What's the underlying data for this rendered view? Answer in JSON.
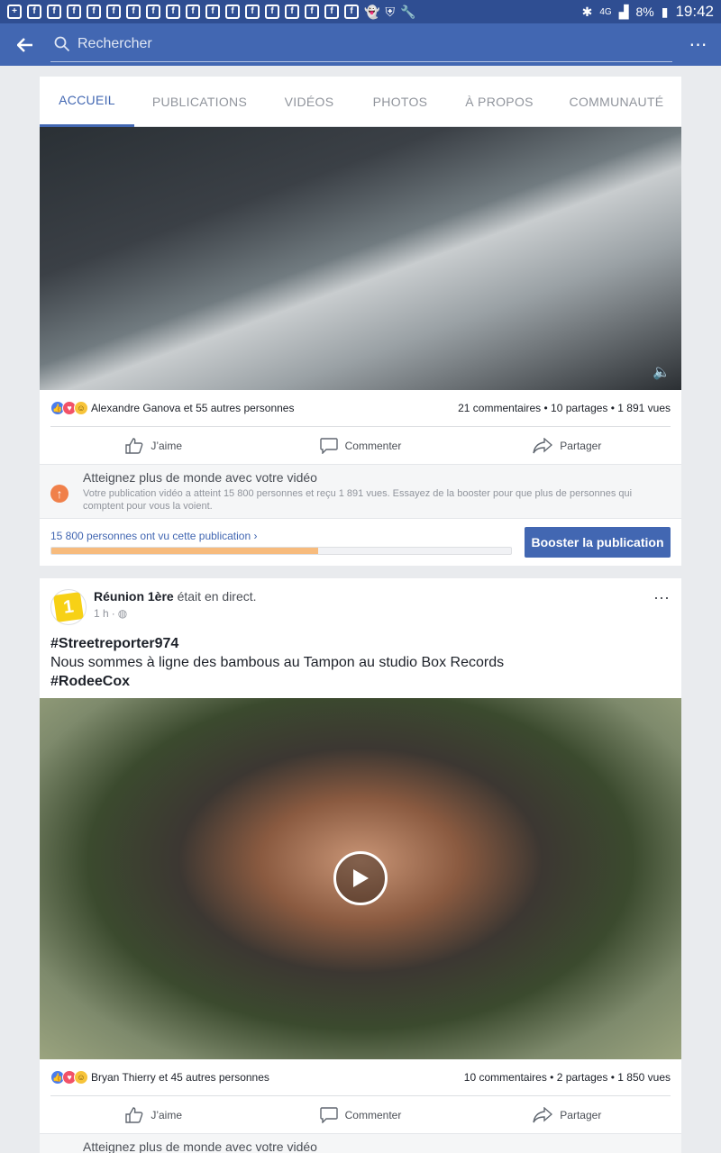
{
  "status_bar": {
    "battery": "8%",
    "time": "19:42",
    "network": "4G"
  },
  "app_bar": {
    "search_placeholder": "Rechercher",
    "more_icon": "overflow-menu-icon"
  },
  "page_tabs": [
    {
      "label": "ACCUEIL",
      "active": true
    },
    {
      "label": "PUBLICATIONS",
      "active": false
    },
    {
      "label": "VIDÉOS",
      "active": false
    },
    {
      "label": "PHOTOS",
      "active": false
    },
    {
      "label": "À PROPOS",
      "active": false
    },
    {
      "label": "COMMUNAUTÉ",
      "active": false
    }
  ],
  "post1": {
    "reactions_text": "Alexandre Ganova et 55 autres personnes",
    "stats_text": "21 commentaires • 10 partages • 1 891 vues",
    "actions": {
      "like": "J’aime",
      "comment": "Commenter",
      "share": "Partager"
    },
    "boost_tip": {
      "title": "Atteignez plus de monde avec votre vidéo",
      "body": "Votre publication vidéo a atteint 15 800 personnes et reçu 1 891 vues. Essayez de la booster pour que plus de personnes qui comptent pour vous la voient."
    },
    "reach_link": "15 800 personnes ont vu cette publication",
    "reach_progress": 0.58,
    "boost_button": "Booster la publication"
  },
  "post2": {
    "page_name": "Réunion 1ère",
    "status": "était en direct.",
    "time": "1 h",
    "hashtag1": "#Streetreporter974",
    "text": "Nous sommes à ligne des bambous au Tampon au studio Box Records",
    "hashtag2": "#RodeeCox",
    "reactions_text": "Bryan Thierry et 45 autres personnes",
    "stats_text": "10 commentaires • 2 partages • 1 850 vues",
    "actions": {
      "like": "J’aime",
      "comment": "Commenter",
      "share": "Partager"
    },
    "boost_tip_title": "Atteignez plus de monde avec votre vidéo"
  },
  "colors": {
    "facebook_blue": "#4267b2",
    "status_bar": "#2f4e92",
    "progress_fill": "#f7bb7d"
  }
}
